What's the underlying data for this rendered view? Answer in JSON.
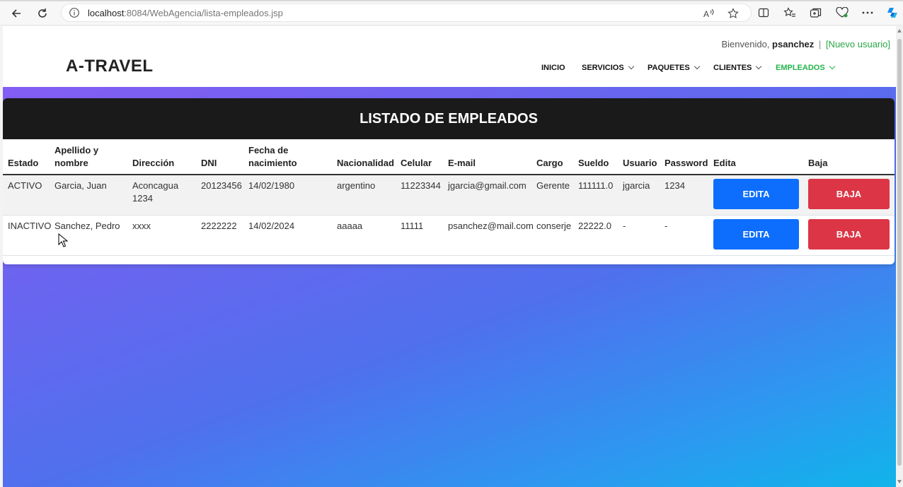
{
  "browser": {
    "url_host": "localhost",
    "url_rest": ":8084/WebAgencia/lista-empleados.jsp"
  },
  "header": {
    "welcome_prefix": "Bienvenido,",
    "username": "psanchez",
    "separator": "|",
    "new_user_link": "[Nuevo usuario]",
    "logo": "A-TRAVEL",
    "menu": [
      {
        "label": "INICIO"
      },
      {
        "label": "SERVICIOS"
      },
      {
        "label": "PAQUETES"
      },
      {
        "label": "CLIENTES"
      },
      {
        "label": "EMPLEADOS"
      }
    ]
  },
  "table": {
    "title": "LISTADO DE EMPLEADOS",
    "columns": {
      "estado": "Estado",
      "apellido_1": "Apellido y",
      "apellido_2": "nombre",
      "direccion": "Dirección",
      "dni": "DNI",
      "fecha_1": "Fecha de",
      "fecha_2": "nacimiento",
      "nacionalidad": "Nacionalidad",
      "celular": "Celular",
      "email": "E-mail",
      "cargo": "Cargo",
      "sueldo": "Sueldo",
      "usuario": "Usuario",
      "password": "Password",
      "edita": "Edita",
      "baja": "Baja"
    },
    "rows": [
      {
        "estado": "ACTIVO",
        "nombre": "Garcia, Juan",
        "direccion_1": "Aconcagua",
        "direccion_2": "1234",
        "dni": "20123456",
        "fecha": "14/02/1980",
        "nacionalidad": "argentino",
        "celular": "11223344",
        "email": "jgarcia@gmail.com",
        "cargo": "Gerente",
        "sueldo": "111111.0",
        "usuario": "jgarcia",
        "password": "1234",
        "edit_label": "EDITA",
        "delete_label": "BAJA"
      },
      {
        "estado": "INACTIVO",
        "nombre": "Sanchez, Pedro",
        "direccion_1": "xxxx",
        "direccion_2": "",
        "dni": "2222222",
        "fecha": "14/02/2024",
        "nacionalidad": "aaaaa",
        "celular": "11111",
        "email": "psanchez@mail.com",
        "cargo": "conserje",
        "sueldo": "22222.0",
        "usuario": "-",
        "password": "-",
        "edit_label": "EDITA",
        "delete_label": "BAJA"
      }
    ]
  },
  "colors": {
    "accent_green": "#22b44b",
    "edit_blue": "#0d6efd",
    "delete_red": "#dc3545",
    "title_bar": "#1a1a1a"
  }
}
